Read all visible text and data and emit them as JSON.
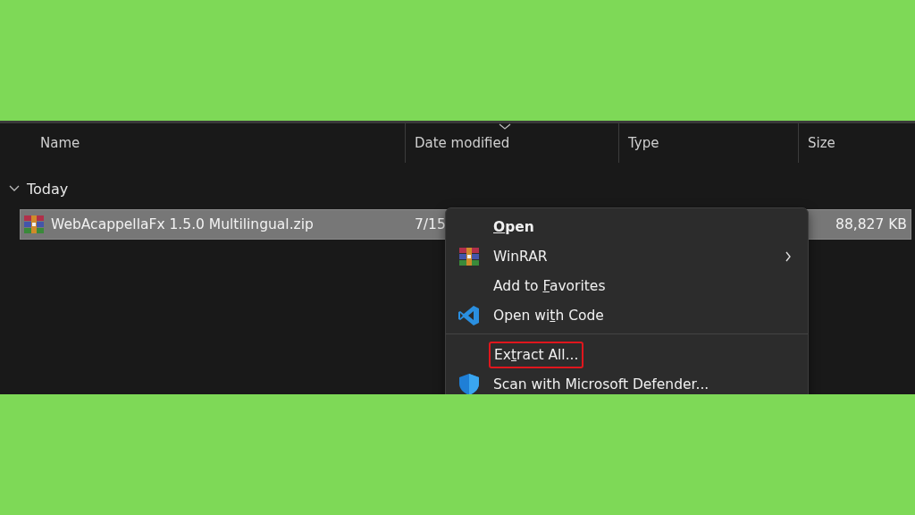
{
  "columns": [
    {
      "label": "Name",
      "sorted": false
    },
    {
      "label": "Date modified",
      "sorted": true
    },
    {
      "label": "Type",
      "sorted": false
    },
    {
      "label": "Size",
      "sorted": false
    }
  ],
  "group": {
    "label": "Today",
    "expanded": true
  },
  "files": [
    {
      "name": "WebAcappellaFx 1.5.0 Multilingual.zip",
      "date": "7/15",
      "size": "88,827 KB",
      "selected": true
    }
  ],
  "context_menu": [
    {
      "kind": "plain",
      "access_key": "O",
      "after": "pen",
      "bold": true,
      "submenu": false,
      "separator_before": false,
      "highlighted": false
    },
    {
      "kind": "archive",
      "before": "WinRAR",
      "bold": false,
      "submenu": true,
      "separator_before": false,
      "highlighted": false
    },
    {
      "kind": "plain",
      "before": "Add to ",
      "access_key": "F",
      "after": "avorites",
      "bold": false,
      "submenu": false,
      "separator_before": false,
      "highlighted": false
    },
    {
      "kind": "code",
      "before": "Open wi",
      "access_key": "t",
      "after": "h Code",
      "bold": false,
      "submenu": false,
      "separator_before": false,
      "highlighted": false
    },
    {
      "kind": "plain",
      "before": "Ex",
      "access_key": "t",
      "after": "ract All...",
      "bold": false,
      "submenu": false,
      "separator_before": true,
      "highlighted": true
    },
    {
      "kind": "shield",
      "before": "Scan with Microsoft Defender...",
      "bold": false,
      "submenu": false,
      "separator_before": false,
      "highlighted": false
    }
  ]
}
